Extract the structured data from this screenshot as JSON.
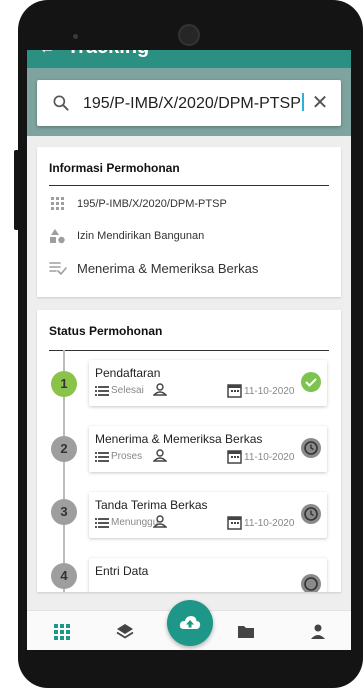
{
  "app_bar": {
    "title": "Tracking"
  },
  "search": {
    "value": "195/P-IMB/X/2020/DPM-PTSP"
  },
  "info_card": {
    "title": "Informasi Permohonan",
    "registration_number": "195/P-IMB/X/2020/DPM-PTSP",
    "permit_type": "Izin Mendirikan Bangunan",
    "current_stage": "Menerima & Memeriksa Berkas"
  },
  "status_card": {
    "title": "Status Permohonan",
    "steps": [
      {
        "number": "1",
        "name": "Pendaftaran",
        "status": "Selesai",
        "date": "11-10-2020",
        "state": "done"
      },
      {
        "number": "2",
        "name": "Menerima & Memeriksa Berkas",
        "status": "Proses",
        "date": "11-10-2020",
        "state": "pending"
      },
      {
        "number": "3",
        "name": "Tanda Terima Berkas",
        "status": "Menunggu",
        "date": "11-10-2020",
        "state": "pending"
      },
      {
        "number": "4",
        "name": "Entri Data",
        "status": "",
        "date": "",
        "state": "pending"
      }
    ]
  },
  "bottom_nav": {
    "items": [
      "grid-icon",
      "layers-icon",
      "cloud-upload-icon",
      "folder-icon",
      "person-icon"
    ]
  },
  "colors": {
    "primary": "#2b8f81",
    "fab": "#1e9788",
    "step_done": "#8bc34a",
    "step_pending": "#9e9e9e",
    "check_green": "#7cc44f"
  }
}
